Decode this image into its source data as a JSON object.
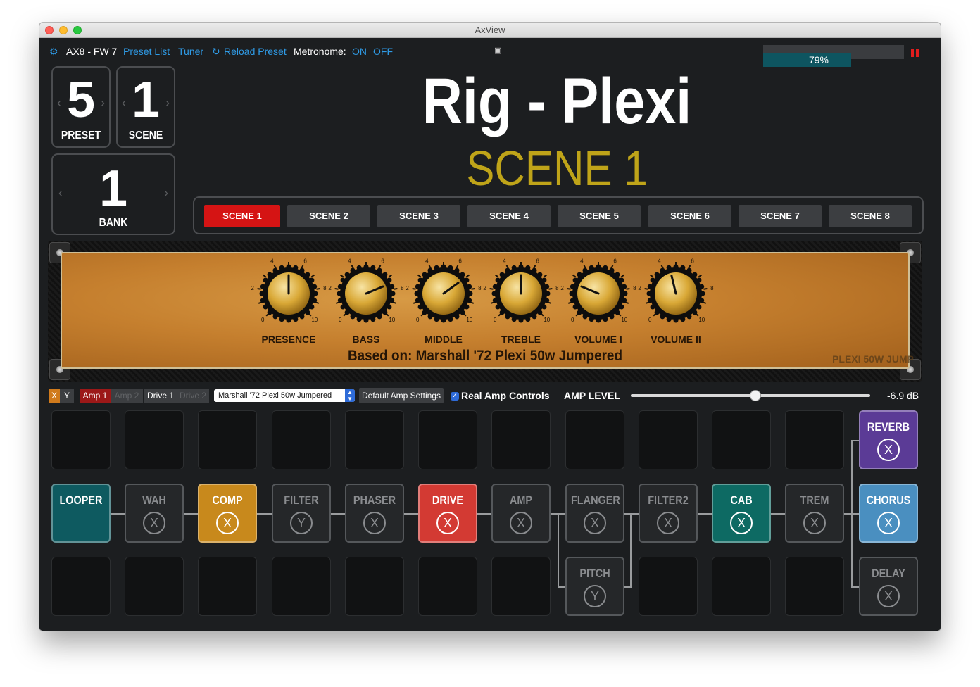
{
  "window": {
    "title": "AxView"
  },
  "topbar": {
    "device": "AX8 - FW 7",
    "preset_list": "Preset List",
    "tuner": "Tuner",
    "reload": "Reload Preset",
    "metronome_label": "Metronome:",
    "metronome_on": "ON",
    "metronome_off": "OFF",
    "cpu_label": "79%",
    "cpu_percent": 79
  },
  "counters": {
    "preset": {
      "value": "5",
      "label": "PRESET"
    },
    "scene": {
      "value": "1",
      "label": "SCENE"
    },
    "bank": {
      "value": "1",
      "label": "BANK"
    }
  },
  "preset_name": "Rig - Plexi",
  "scene_name": "SCENE 1",
  "scenes": [
    "SCENE 1",
    "SCENE 2",
    "SCENE 3",
    "SCENE 4",
    "SCENE 5",
    "SCENE 6",
    "SCENE 7",
    "SCENE 8"
  ],
  "active_scene": 0,
  "amp": {
    "scale_labels": {
      "min": "0",
      "max": "10",
      "l2": "2",
      "l4": "4",
      "l6": "6",
      "l8": "8"
    },
    "knobs": [
      {
        "label": "PRESENCE",
        "value": 5.0
      },
      {
        "label": "BASS",
        "value": 7.5
      },
      {
        "label": "MIDDLE",
        "value": 7.0
      },
      {
        "label": "TREBLE",
        "value": 5.0
      },
      {
        "label": "VOLUME I",
        "value": 2.5
      },
      {
        "label": "VOLUME II",
        "value": 4.5
      }
    ],
    "based_on": "Based on: Marshall '72 Plexi 50w Jumpered",
    "model_tag": "PLEXI 50W JUMP"
  },
  "controls": {
    "x": "X",
    "y": "Y",
    "amp1": "Amp 1",
    "amp2": "Amp 2",
    "drive1": "Drive 1",
    "drive2": "Drive 2",
    "amp_model": "Marshall '72 Plexi 50w Jumpered",
    "default_btn": "Default Amp Settings",
    "real_controls": "Real Amp Controls",
    "amp_level_label": "AMP LEVEL",
    "amp_level_value": "-6.9 dB",
    "amp_level_fraction": 0.52
  },
  "blocks": {
    "looper": {
      "name": "LOOPER",
      "state": ""
    },
    "wah": {
      "name": "WAH",
      "state": "X"
    },
    "comp": {
      "name": "COMP",
      "state": "X"
    },
    "filter": {
      "name": "FILTER",
      "state": "Y"
    },
    "phaser": {
      "name": "PHASER",
      "state": "X"
    },
    "drive": {
      "name": "DRIVE",
      "state": "X"
    },
    "amp": {
      "name": "AMP",
      "state": "X"
    },
    "flanger": {
      "name": "FLANGER",
      "state": "X"
    },
    "filter2": {
      "name": "FILTER2",
      "state": "X"
    },
    "cab": {
      "name": "CAB",
      "state": "X"
    },
    "trem": {
      "name": "TREM",
      "state": "X"
    },
    "reverb": {
      "name": "REVERB",
      "state": "X"
    },
    "chorus": {
      "name": "CHORUS",
      "state": "X"
    },
    "pitch": {
      "name": "PITCH",
      "state": "Y"
    },
    "delay": {
      "name": "DELAY",
      "state": "X"
    }
  },
  "colors": {
    "accent_blue": "#2f9be6",
    "scene_active": "#d51414",
    "scene_title": "#bfa419",
    "looper": "#0e5a60",
    "comp": "#c8891c",
    "drive": "#d33a33",
    "cab": "#0d6a63",
    "reverb": "#5b3b96",
    "chorus": "#4a8fc0"
  }
}
